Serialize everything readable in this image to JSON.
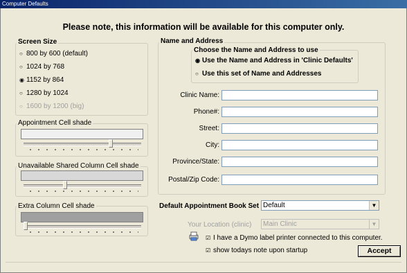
{
  "window": {
    "title": "Computer Defaults"
  },
  "notice": "Please note, this information will be available for this computer only.",
  "screen_size": {
    "title": "Screen Size",
    "options": [
      {
        "label": "800 by 600 (default)",
        "selected": false,
        "enabled": true
      },
      {
        "label": "1024 by 768",
        "selected": false,
        "enabled": true
      },
      {
        "label": "1152 by 864",
        "selected": true,
        "enabled": true
      },
      {
        "label": "1280 by 1024",
        "selected": false,
        "enabled": true
      },
      {
        "label": "1600 by 1200 (big)",
        "selected": false,
        "enabled": false
      }
    ]
  },
  "shades": [
    {
      "title": "Appointment Cell shade",
      "color": "#f0f0f0",
      "level": 0.75
    },
    {
      "title": "Unavailable Shared Column Cell shade",
      "color": "#d8d8d8",
      "level": 0.35
    },
    {
      "title": "Extra Column Cell shade",
      "color": "#a0a0a0",
      "level": 0.0
    }
  ],
  "name_address": {
    "title": "Name and Address",
    "choose_title": "Choose the Name and Address to use",
    "options": [
      {
        "label": "Use the Name and Address in 'Clinic Defaults'",
        "selected": true
      },
      {
        "label": "Use this set of Name and Addresses",
        "selected": false
      }
    ],
    "fields": [
      {
        "label": "Clinic Name:",
        "value": ""
      },
      {
        "label": "Phone#:",
        "value": ""
      },
      {
        "label": "Street:",
        "value": ""
      },
      {
        "label": "City:",
        "value": ""
      },
      {
        "label": "Province/State:",
        "value": ""
      },
      {
        "label": "Postal/Zip Code:",
        "value": ""
      }
    ]
  },
  "book_set": {
    "label": "Default Appointment Book Set",
    "value": "Default"
  },
  "location": {
    "label": "Your Location (clinic)",
    "value": "Main Clinic"
  },
  "checks": {
    "dymo": {
      "label": "I have a Dymo label printer connected to this computer.",
      "checked": true
    },
    "todays_note": {
      "label": "show todays note upon startup",
      "checked": true
    }
  },
  "accept_label": "Accept",
  "icons": {
    "printer": "printer-icon"
  }
}
